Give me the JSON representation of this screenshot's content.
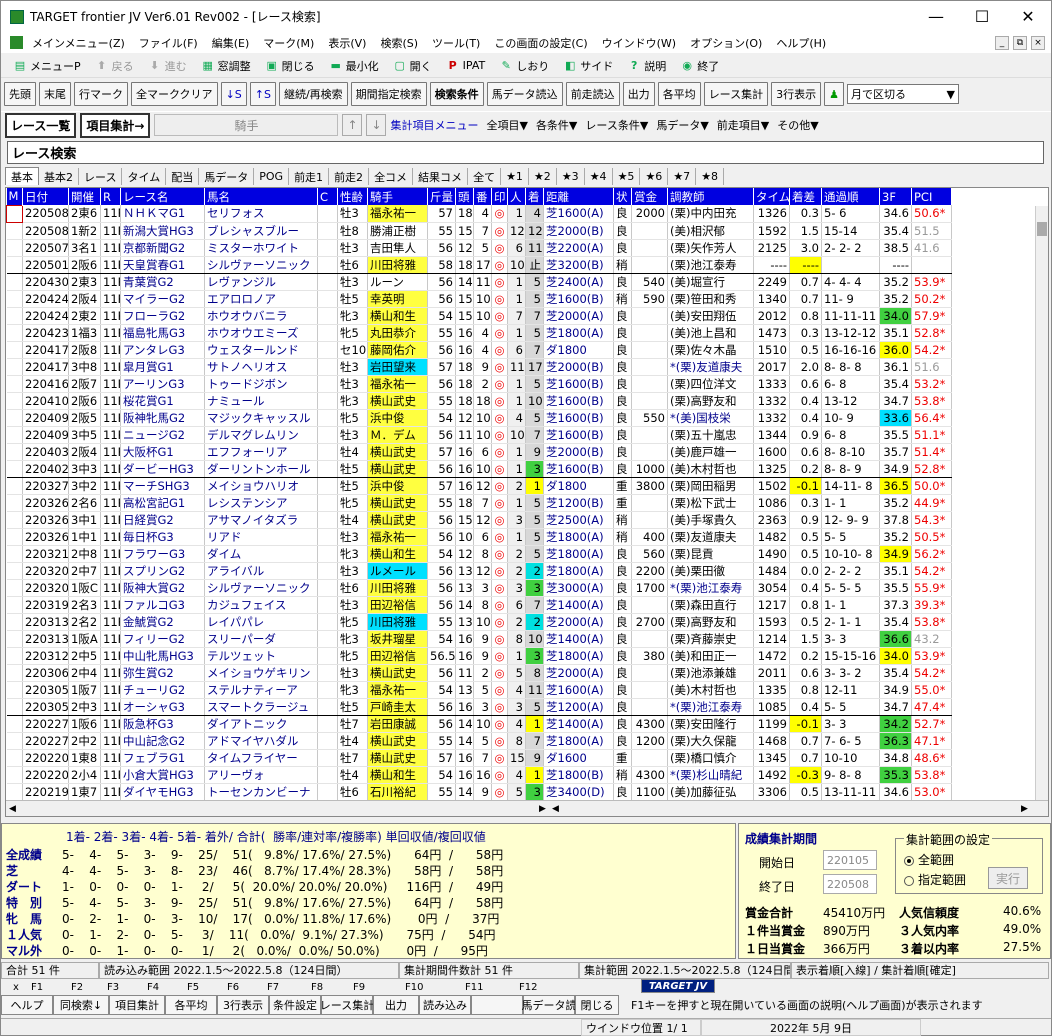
{
  "window": {
    "title": "TARGET frontier JV  Ver6.01  Rev002 - [レース検索]",
    "min": "—",
    "max": "☐",
    "close": "✕"
  },
  "menu": [
    "メインメニュー(Z)",
    "ファイル(F)",
    "編集(E)",
    "マーク(M)",
    "表示(V)",
    "検索(S)",
    "ツール(T)",
    "この画面の設定(C)",
    "ウインドウ(W)",
    "オプション(O)",
    "ヘルプ(H)"
  ],
  "toolbar1": [
    {
      "icon": "menu-icon",
      "label": "メニューP",
      "enabled": true
    },
    {
      "icon": "back-arrow-icon",
      "label": "戻る",
      "enabled": false
    },
    {
      "icon": "forward-arrow-icon",
      "label": "進む",
      "enabled": false
    },
    {
      "icon": "window-arrange-icon",
      "label": "窓調整",
      "enabled": true
    },
    {
      "icon": "close-window-icon",
      "label": "閉じる",
      "enabled": true
    },
    {
      "icon": "minimize-icon",
      "label": "最小化",
      "enabled": true
    },
    {
      "icon": "open-icon",
      "label": "開く",
      "enabled": true
    },
    {
      "icon": "ipat-icon",
      "label": "IPAT",
      "enabled": true
    },
    {
      "icon": "bookmark-icon",
      "label": "しおり",
      "enabled": true
    },
    {
      "icon": "side-icon",
      "label": "サイド",
      "enabled": true
    },
    {
      "icon": "help-book-icon",
      "label": "説明",
      "enabled": true
    },
    {
      "icon": "exit-icon",
      "label": "終了",
      "enabled": true
    }
  ],
  "toolbar2": [
    "先頭",
    "末尾",
    "行マーク",
    "全マーククリア",
    "↓S",
    "↑S",
    "継続/再検索",
    "期間指定検索",
    "検索条件",
    "馬データ読込",
    "前走読込",
    "出力",
    "各平均",
    "レース集計",
    "3行表示"
  ],
  "toolbar2_combo": "月で区切る",
  "toolbar3": {
    "race_list": "レース一覧",
    "item_agg": "項目集計→",
    "jockey": "騎手",
    "agg_menu": "集計項目メニュー",
    "dropdowns": [
      "全項目▼",
      "各条件▼",
      "レース条件▼",
      "馬データ▼",
      "前走項目▼",
      "その他▼"
    ]
  },
  "panel_title": "レース検索",
  "tabs": [
    "基本",
    "基本2",
    "レース",
    "タイム",
    "配当",
    "馬データ",
    "POG",
    "前走1",
    "前走2",
    "全コメ",
    "結果コメ",
    "全て",
    "★1",
    "★2",
    "★3",
    "★4",
    "★5",
    "★6",
    "★7",
    "★8"
  ],
  "columns": [
    "M",
    "日付",
    "開催",
    "R",
    "レース名",
    "馬名",
    "C",
    "性齢",
    "騎手",
    "斤量",
    "頭",
    "番",
    "印",
    "人",
    "着",
    "距離",
    "状",
    "賞金",
    "調教師",
    "タイム",
    "着差",
    "通過順",
    "3F",
    "PCI"
  ],
  "rows": [
    [
      "",
      "220508",
      "2東6",
      "11R",
      "ＮＨＫマG1",
      "セリフォス",
      "",
      "牡3",
      "福永祐一",
      "57",
      "18",
      "4",
      "◎",
      "1",
      "4",
      "芝1600(A)",
      "良",
      "2000",
      "(栗)中内田充",
      "1326",
      "0.3",
      "5- 6",
      "34.6",
      "50.6*"
    ],
    [
      "",
      "220508",
      "1新2",
      "11R",
      "新潟大賞HG3",
      "ブレシャスブルー",
      "",
      "牡8",
      "勝浦正樹",
      "55",
      "15",
      "7",
      "◎",
      "12",
      "12",
      "芝2000(B)",
      "良",
      "",
      "(美)相沢郁",
      "1592",
      "1.5",
      "15-14",
      "35.4",
      "51.5"
    ],
    [
      "",
      "220507",
      "3名1",
      "11R",
      "京都新聞G2",
      "ミスターホワイト",
      "",
      "牡3",
      "吉田隼人",
      "56",
      "12",
      "5",
      "◎",
      "6",
      "11",
      "芝2200(A)",
      "良",
      "",
      "(栗)矢作芳人",
      "2125",
      "3.0",
      "2- 2- 2",
      "38.5",
      "41.6"
    ],
    [
      "",
      "220501",
      "2阪6",
      "11R",
      "天皇賞春G1",
      "シルヴァーソニック",
      "",
      "牡6",
      "川田将雅",
      "58",
      "18",
      "17",
      "◎",
      "10",
      "止",
      "芝3200(B)",
      "稍",
      "",
      "(栗)池江泰寿",
      "----",
      "----",
      "",
      "----",
      ""
    ],
    [
      "",
      "220430",
      "2東3",
      "11R",
      "青葉賞G2",
      "レヴァンジル",
      "",
      "牡3",
      "ルーン",
      "56",
      "14",
      "11",
      "◎",
      "1",
      "5",
      "芝2400(A)",
      "良",
      "540",
      "(美)堀宣行",
      "2249",
      "0.7",
      "4- 4- 4",
      "35.2",
      "53.9*"
    ],
    [
      "",
      "220424",
      "2阪4",
      "11R",
      "マイラーG2",
      "エアロロノア",
      "",
      "牡5",
      "幸英明",
      "56",
      "15",
      "10",
      "◎",
      "1",
      "5",
      "芝1600(B)",
      "稍",
      "590",
      "(栗)笹田和秀",
      "1340",
      "0.7",
      "11- 9",
      "35.2",
      "50.2*"
    ],
    [
      "",
      "220424",
      "2東2",
      "11R",
      "フローラG2",
      "ホウオウバニラ",
      "",
      "牝3",
      "横山和生",
      "54",
      "15",
      "10",
      "◎",
      "7",
      "7",
      "芝2000(A)",
      "良",
      "",
      "(美)安田翔伍",
      "2012",
      "0.8",
      "11-11-11",
      "34.0",
      "57.9*"
    ],
    [
      "",
      "220423",
      "1福3",
      "11R",
      "福島牝馬G3",
      "ホウオウエミーズ",
      "",
      "牝5",
      "丸田恭介",
      "55",
      "16",
      "4",
      "◎",
      "1",
      "5",
      "芝1800(A)",
      "良",
      "",
      "(美)池上昌和",
      "1473",
      "0.3",
      "13-12-12",
      "35.1",
      "52.8*"
    ],
    [
      "",
      "220417",
      "2阪8",
      "11R",
      "アンタレG3",
      "ウェスタールンド",
      "",
      "セ10",
      "藤岡佑介",
      "56",
      "16",
      "4",
      "◎",
      "6",
      "7",
      "ダ1800",
      "良",
      "",
      "(栗)佐々木晶",
      "1510",
      "0.5",
      "16-16-16",
      "36.0",
      "54.2*"
    ],
    [
      "",
      "220417",
      "3中8",
      "11R",
      "皐月賞G1",
      "サトノヘリオス",
      "",
      "牡3",
      "岩田望来",
      "57",
      "18",
      "9",
      "◎",
      "11",
      "17",
      "芝2000(B)",
      "良",
      "",
      "*(栗)友道康夫",
      "2017",
      "2.0",
      "8- 8- 8",
      "36.1",
      "51.6"
    ],
    [
      "",
      "220416",
      "2阪7",
      "11R",
      "アーリンG3",
      "トゥードジボン",
      "",
      "牡3",
      "福永祐一",
      "56",
      "18",
      "2",
      "◎",
      "1",
      "5",
      "芝1600(B)",
      "良",
      "",
      "(栗)四位洋文",
      "1333",
      "0.6",
      "6- 8",
      "35.4",
      "53.2*"
    ],
    [
      "",
      "220410",
      "2阪6",
      "11R",
      "桜花賞G1",
      "ナミュール",
      "",
      "牝3",
      "横山武史",
      "55",
      "18",
      "18",
      "◎",
      "1",
      "10",
      "芝1600(B)",
      "良",
      "",
      "(栗)高野友和",
      "1332",
      "0.4",
      "13-12",
      "34.7",
      "53.8*"
    ],
    [
      "",
      "220409",
      "2阪5",
      "11R",
      "阪神牝馬G2",
      "マジックキャッスル",
      "",
      "牝5",
      "浜中俊",
      "54",
      "12",
      "10",
      "◎",
      "4",
      "5",
      "芝1600(B)",
      "良",
      "550",
      "*(美)国枝栄",
      "1332",
      "0.4",
      "10- 9",
      "33.6",
      "56.4*"
    ],
    [
      "",
      "220409",
      "3中5",
      "11R",
      "ニュージG2",
      "デルマグレムリン",
      "",
      "牡3",
      "Ｍ．デム",
      "56",
      "11",
      "10",
      "◎",
      "10",
      "7",
      "芝1600(B)",
      "良",
      "",
      "(栗)五十嵐忠",
      "1344",
      "0.9",
      "6- 8",
      "35.5",
      "51.1*"
    ],
    [
      "",
      "220403",
      "2阪4",
      "11R",
      "大阪杯G1",
      "エフフォーリア",
      "",
      "牡4",
      "横山武史",
      "57",
      "16",
      "6",
      "◎",
      "1",
      "9",
      "芝2000(B)",
      "良",
      "",
      "(美)鹿戸雄一",
      "1600",
      "0.6",
      "8- 8-10",
      "35.7",
      "51.4*"
    ],
    [
      "",
      "220402",
      "3中3",
      "11R",
      "ダービーHG3",
      "ダーリントンホール",
      "",
      "牡5",
      "横山武史",
      "56",
      "16",
      "10",
      "◎",
      "1",
      "3",
      "芝1600(B)",
      "良",
      "1000",
      "(美)木村哲也",
      "1325",
      "0.2",
      "8- 8- 9",
      "34.9",
      "52.8*"
    ],
    [
      "",
      "220327",
      "3中2",
      "11R",
      "マーチSHG3",
      "メイショウハリオ",
      "",
      "牡5",
      "浜中俊",
      "57",
      "16",
      "12",
      "◎",
      "2",
      "1",
      "ダ1800",
      "重",
      "3800",
      "(栗)岡田稲男",
      "1502",
      "-0.1",
      "14-11- 8",
      "36.5",
      "50.0*"
    ],
    [
      "",
      "220326",
      "2名6",
      "11R",
      "高松宮記G1",
      "レシステンシア",
      "",
      "牝5",
      "横山武史",
      "55",
      "18",
      "7",
      "◎",
      "1",
      "5",
      "芝1200(B)",
      "重",
      "",
      "(栗)松下武士",
      "1086",
      "0.3",
      "1- 1",
      "35.2",
      "44.9*"
    ],
    [
      "",
      "220326",
      "3中1",
      "11R",
      "日経賞G2",
      "アサマノイタズラ",
      "",
      "牡4",
      "横山武史",
      "56",
      "15",
      "12",
      "◎",
      "3",
      "5",
      "芝2500(A)",
      "稍",
      "",
      "(美)手塚貴久",
      "2363",
      "0.9",
      "12- 9- 9",
      "37.8",
      "54.3*"
    ],
    [
      "",
      "220326",
      "1中1",
      "11R",
      "毎日杯G3",
      "リアド",
      "",
      "牡3",
      "福永祐一",
      "56",
      "10",
      "6",
      "◎",
      "1",
      "5",
      "芝1800(A)",
      "稍",
      "400",
      "(栗)友道康夫",
      "1482",
      "0.5",
      "5- 5",
      "35.2",
      "50.5*"
    ],
    [
      "",
      "220321",
      "2中8",
      "11R",
      "フラワーG3",
      "ダイム",
      "",
      "牝3",
      "横山和生",
      "54",
      "12",
      "8",
      "◎",
      "2",
      "5",
      "芝1800(A)",
      "良",
      "560",
      "(栗)昆貢",
      "1490",
      "0.5",
      "10-10- 8",
      "34.9",
      "56.2*"
    ],
    [
      "",
      "220320",
      "2中7",
      "11R",
      "スプリンG2",
      "アライバル",
      "",
      "牡3",
      "ルメール",
      "56",
      "13",
      "12",
      "◎",
      "2",
      "2",
      "芝1800(A)",
      "良",
      "2200",
      "(美)栗田徹",
      "1484",
      "0.0",
      "2- 2- 2",
      "35.1",
      "54.2*"
    ],
    [
      "",
      "220320",
      "1阪C",
      "11R",
      "阪神大賞G2",
      "シルヴァーソニック",
      "",
      "牡6",
      "川田将雅",
      "56",
      "13",
      "3",
      "◎",
      "3",
      "3",
      "芝3000(A)",
      "良",
      "1700",
      "*(栗)池江泰寿",
      "3054",
      "0.4",
      "5- 5- 5",
      "35.5",
      "55.9*"
    ],
    [
      "",
      "220319",
      "2名3",
      "11R",
      "ファルコG3",
      "カジュフェイス",
      "",
      "牡3",
      "田辺裕信",
      "56",
      "14",
      "8",
      "◎",
      "6",
      "7",
      "芝1400(A)",
      "良",
      "",
      "(栗)森田直行",
      "1217",
      "0.8",
      "1- 1",
      "37.3",
      "39.3*"
    ],
    [
      "",
      "220313",
      "2名2",
      "11R",
      "金鯱賞G2",
      "レイパパレ",
      "",
      "牝5",
      "川田将雅",
      "55",
      "13",
      "10",
      "◎",
      "2",
      "2",
      "芝2000(A)",
      "良",
      "2700",
      "(栗)高野友和",
      "1593",
      "0.5",
      "2- 1- 1",
      "35.4",
      "53.8*"
    ],
    [
      "",
      "220313",
      "1阪A",
      "11R",
      "フィリーG2",
      "スリーパーダ",
      "",
      "牝3",
      "坂井瑠星",
      "54",
      "16",
      "9",
      "◎",
      "8",
      "10",
      "芝1400(A)",
      "良",
      "",
      "(栗)斉藤崇史",
      "1214",
      "1.5",
      "3- 3",
      "36.6",
      "43.2"
    ],
    [
      "",
      "220312",
      "2中5",
      "11R",
      "中山牝馬HG3",
      "テルツェット",
      "",
      "牝5",
      "田辺裕信",
      "56.5",
      "16",
      "9",
      "◎",
      "1",
      "3",
      "芝1800(A)",
      "良",
      "380",
      "(美)和田正一",
      "1472",
      "0.2",
      "15-15-16",
      "34.0",
      "53.9*"
    ],
    [
      "",
      "220306",
      "2中4",
      "11R",
      "弥生賞G2",
      "メイショウゲキリン",
      "",
      "牡3",
      "横山武史",
      "56",
      "11",
      "2",
      "◎",
      "5",
      "8",
      "芝2000(A)",
      "良",
      "",
      "(栗)池添兼雄",
      "2011",
      "0.6",
      "3- 3- 2",
      "35.4",
      "54.2*"
    ],
    [
      "",
      "220305",
      "1阪7",
      "11R",
      "チューリG2",
      "ステルナティーア",
      "",
      "牝3",
      "福永祐一",
      "54",
      "13",
      "5",
      "◎",
      "4",
      "11",
      "芝1600(A)",
      "良",
      "",
      "(美)木村哲也",
      "1335",
      "0.8",
      "12-11",
      "34.9",
      "55.0*"
    ],
    [
      "",
      "220305",
      "2中3",
      "11R",
      "オーシャG3",
      "スマートクラージュ",
      "",
      "牡5",
      "戸崎圭太",
      "56",
      "16",
      "3",
      "◎",
      "3",
      "5",
      "芝1200(A)",
      "良",
      "",
      "*(栗)池江泰寿",
      "1085",
      "0.4",
      "5- 5",
      "34.7",
      "47.4*"
    ],
    [
      "",
      "220227",
      "1阪6",
      "11R",
      "阪急杯G3",
      "ダイアトニック",
      "",
      "牡7",
      "岩田康誠",
      "56",
      "14",
      "10",
      "◎",
      "4",
      "1",
      "芝1400(A)",
      "良",
      "4300",
      "(栗)安田隆行",
      "1199",
      "-0.1",
      "3- 3",
      "34.2",
      "52.7*"
    ],
    [
      "",
      "220227",
      "2中2",
      "11R",
      "中山記念G2",
      "アドマイヤハダル",
      "",
      "牡4",
      "横山武史",
      "55",
      "14",
      "5",
      "◎",
      "8",
      "7",
      "芝1800(A)",
      "良",
      "1200",
      "(栗)大久保龍",
      "1468",
      "0.7",
      "7- 6- 5",
      "36.3",
      "47.1*"
    ],
    [
      "",
      "220220",
      "1東8",
      "11R",
      "フェブラG1",
      "タイムフライヤー",
      "",
      "牡7",
      "横山武史",
      "57",
      "16",
      "7",
      "◎",
      "15",
      "9",
      "ダ1600",
      "重",
      "",
      "(栗)橋口慎介",
      "1345",
      "0.7",
      "10-10",
      "34.8",
      "48.6*"
    ],
    [
      "",
      "220220",
      "2小4",
      "11R",
      "小倉大賞HG3",
      "アリーヴォ",
      "",
      "牡4",
      "横山和生",
      "54",
      "16",
      "16",
      "◎",
      "4",
      "1",
      "芝1800(B)",
      "稍",
      "4300",
      "*(栗)杉山晴紀",
      "1492",
      "-0.3",
      "9- 8- 8",
      "35.3",
      "53.8*"
    ],
    [
      "",
      "220219",
      "1東7",
      "11R",
      "ダイヤモHG3",
      "トーセンカンビーナ",
      "",
      "牡6",
      "石川裕紀",
      "55",
      "14",
      "9",
      "◎",
      "5",
      "3",
      "芝3400(D)",
      "良",
      "1100",
      "(美)加藤征弘",
      "3306",
      "0.5",
      "13-11-11",
      "34.6",
      "53.0*"
    ]
  ],
  "stats": {
    "header": "1着- 2着- 3着- 4着- 5着- 着外/ 合計(  勝率/連対率/複勝率) 単回収値/複回収値",
    "rows": [
      {
        "label": "全成績",
        "values": "5-    4-    5-    3-    9-    25/    51(   9.8%/ 17.6%/ 27.5%)      64円  /      58円"
      },
      {
        "label": "芝",
        "values": "4-    4-    5-    3-    8-    23/    46(   8.7%/ 17.4%/ 28.3%)      58円  /      58円"
      },
      {
        "label": "ダート",
        "values": "1-    0-    0-    0-    1-     2/     5(  20.0%/ 20.0%/ 20.0%)     116円  /      49円"
      },
      {
        "label": "特　別",
        "values": "5-    4-    5-    3-    9-    25/    51(   9.8%/ 17.6%/ 27.5%)      64円  /      58円"
      },
      {
        "label": "牝　馬",
        "values": "0-    2-    1-    0-    3-    10/    17(   0.0%/ 11.8%/ 17.6%)       0円  /      37円"
      },
      {
        "label": "１人気",
        "values": "0-    1-    2-    0-    5-     3/    11(   0.0%/  9.1%/ 27.3%)      75円  /      54円"
      },
      {
        "label": "マル外",
        "values": "0-    0-    1-    0-    0-     1/     2(   0.0%/  0.0%/ 50.0%)       0円  /      95円"
      }
    ]
  },
  "period": {
    "title": "成績集計期間",
    "start_label": "開始日",
    "start": "220105",
    "end_label": "終了日",
    "end": "220508",
    "range_title": "集計範囲の設定",
    "opt_all": "全範囲",
    "opt_range": "指定範囲",
    "run": "実行",
    "totals": [
      {
        "k": "賞金合計",
        "v": "45410万円"
      },
      {
        "k": "１件当賞金",
        "v": "890万円"
      },
      {
        "k": "１日当賞金",
        "v": "366万円"
      }
    ],
    "rates": [
      {
        "k": "人気信頼度",
        "v": "40.6%"
      },
      {
        "k": "３人気内率",
        "v": "49.0%"
      },
      {
        "k": "３着以内率",
        "v": "27.5%"
      }
    ]
  },
  "status": {
    "count": "合計 51 件",
    "load": "読み込み範囲 2022.1.5～2022.5.8（124日間）",
    "agg": "集計期間件数計 51 件",
    "range": "集計範囲 2022.1.5～2022.5.8（124日間）",
    "mode": "表示着順[入線] / 集計着順[確定]"
  },
  "fkeys": [
    "x",
    "F1",
    "F2",
    "F3",
    "F4",
    "F5",
    "F6",
    "F7",
    "F8",
    "F9",
    "F10",
    "F11",
    "F12"
  ],
  "fbuttons": [
    "ヘルプ",
    "同検索↓",
    "項目集計",
    "各平均",
    "3行表示",
    "条件設定",
    "レース集計",
    "出力",
    "読み込み",
    "",
    "馬データ読",
    "閉じる"
  ],
  "fbrand": "TARGET JV",
  "fhelp": "F1キーを押すと現在開いている画面の説明(ヘルプ画面)が表示されます",
  "bottom": {
    "winpos": "ウインドウ位置  1/ 1",
    "date": "2022年  5月  9日"
  }
}
